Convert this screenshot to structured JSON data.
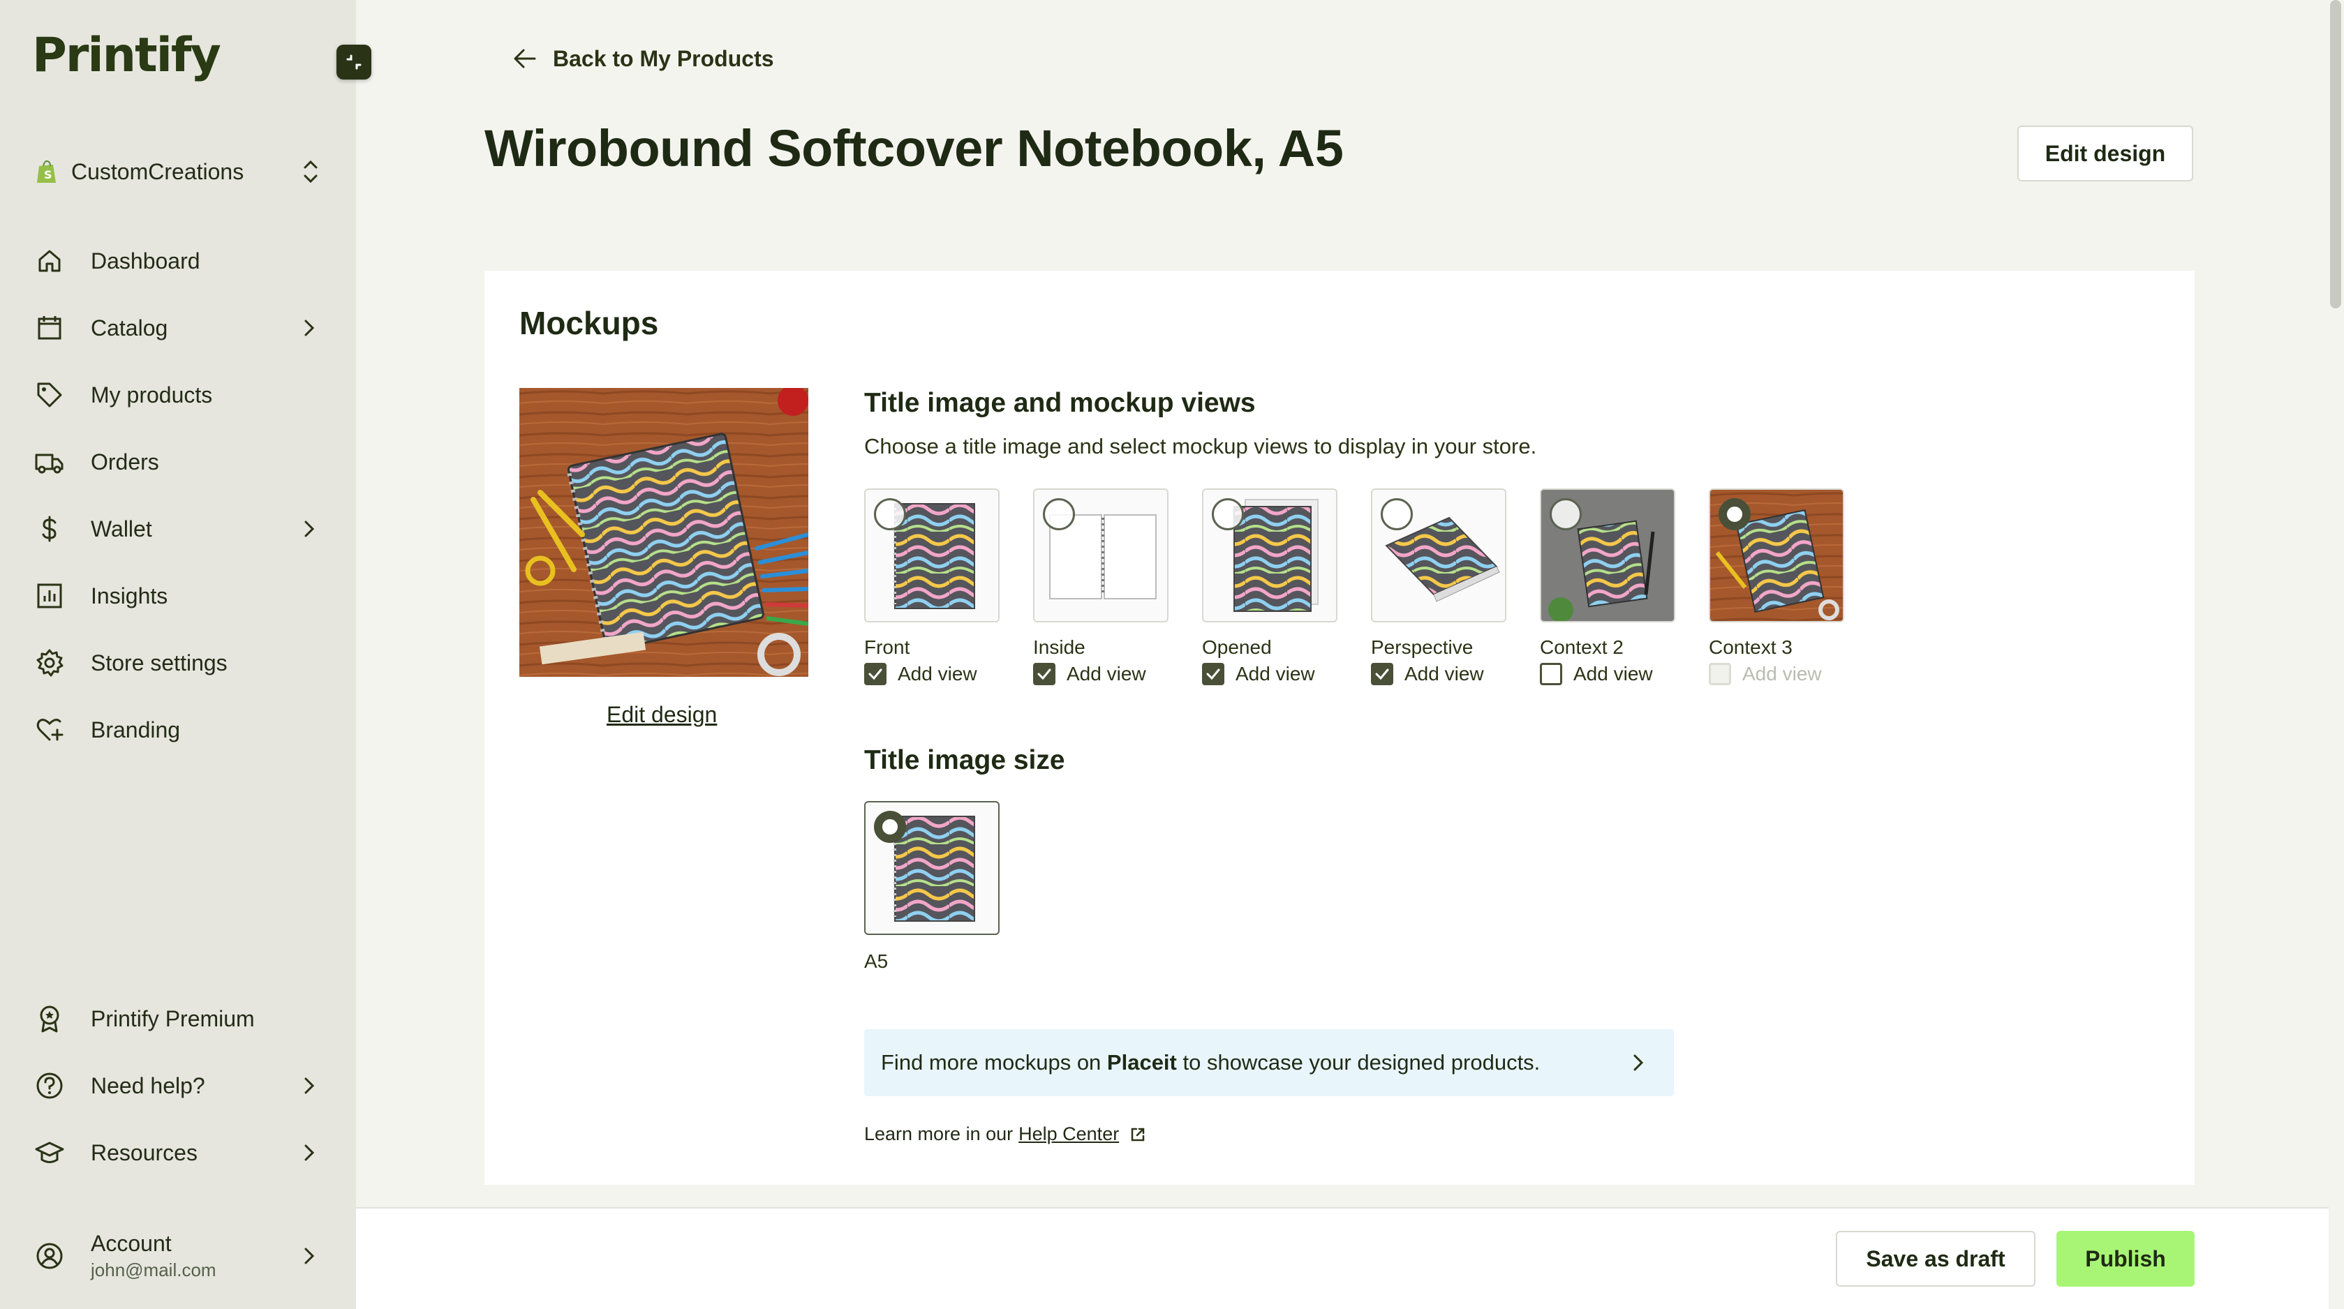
{
  "brand": {
    "logo_text": "Printify"
  },
  "store": {
    "name": "CustomCreations"
  },
  "nav": {
    "items": [
      {
        "label": "Dashboard"
      },
      {
        "label": "Catalog"
      },
      {
        "label": "My products"
      },
      {
        "label": "Orders"
      },
      {
        "label": "Wallet"
      },
      {
        "label": "Insights"
      },
      {
        "label": "Store settings"
      },
      {
        "label": "Branding"
      }
    ],
    "bottom": [
      {
        "label": "Printify Premium"
      },
      {
        "label": "Need help?"
      },
      {
        "label": "Resources"
      }
    ],
    "account": {
      "label": "Account",
      "email": "john@mail.com"
    }
  },
  "header": {
    "back_label": "Back to My Products",
    "title": "Wirobound Softcover Notebook, A5",
    "edit_design_label": "Edit design"
  },
  "mockups": {
    "title": "Mockups",
    "edit_design_link": "Edit design",
    "views_title": "Title image and mockup views",
    "views_desc": "Choose a title image and select mockup views to display in your store.",
    "add_view_label": "Add view",
    "views": [
      {
        "name": "Front",
        "checked": true,
        "disabled": false,
        "selected": false
      },
      {
        "name": "Inside",
        "checked": true,
        "disabled": false,
        "selected": false
      },
      {
        "name": "Opened",
        "checked": true,
        "disabled": false,
        "selected": false
      },
      {
        "name": "Perspective",
        "checked": true,
        "disabled": false,
        "selected": false
      },
      {
        "name": "Context 2",
        "checked": false,
        "disabled": false,
        "selected": false
      },
      {
        "name": "Context 3",
        "checked": false,
        "disabled": true,
        "selected": true
      }
    ],
    "size_title": "Title image size",
    "size_option": "A5",
    "placeit_pre": "Find more mockups on ",
    "placeit_brand": "Placeit",
    "placeit_post": " to showcase your designed products.",
    "learn_pre": "Learn more in our",
    "help_center": "Help Center"
  },
  "footer": {
    "save_draft_label": "Save as draft",
    "publish_label": "Publish"
  },
  "colors": {
    "sidebar_bg": "#e6e6de",
    "page_bg": "#f4f4ef",
    "accent_green": "#a8f575",
    "dark_olive": "#2a3315",
    "info_bg": "#e8f5fb"
  }
}
